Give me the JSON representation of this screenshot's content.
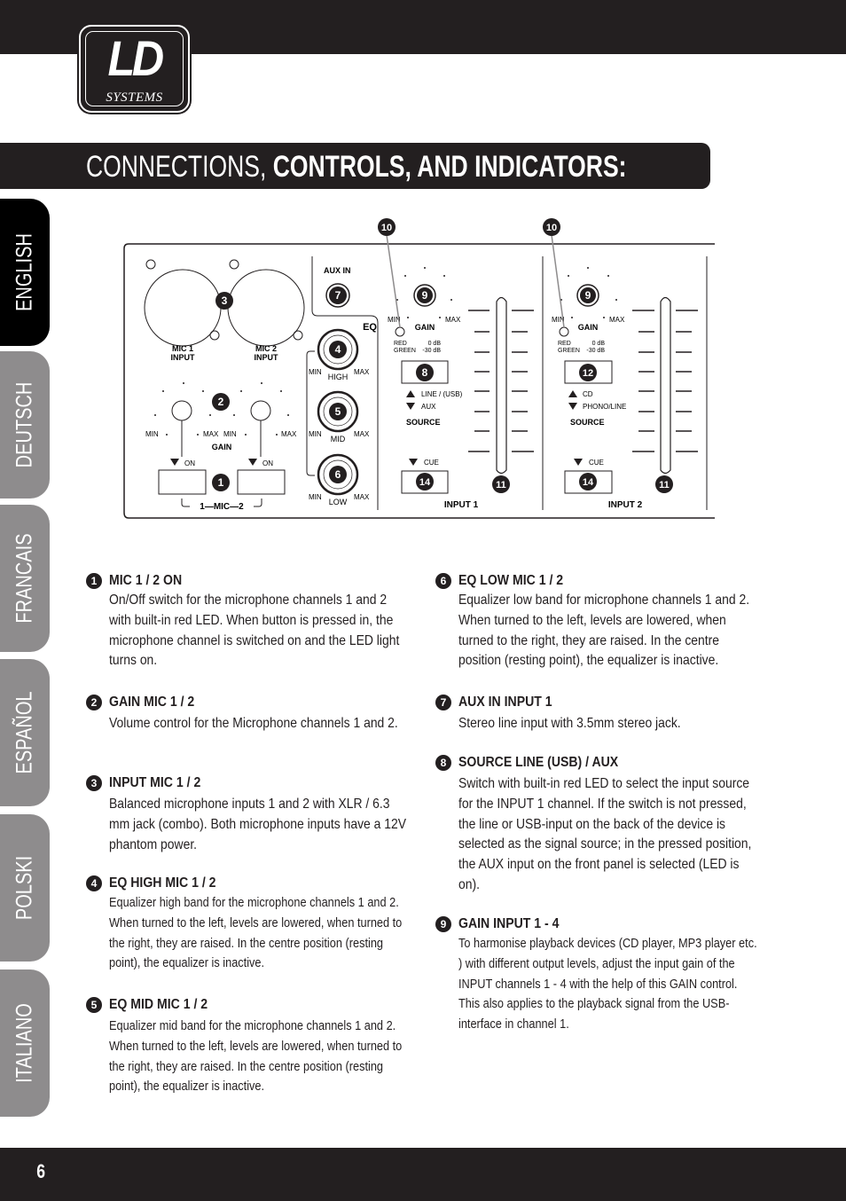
{
  "brand": {
    "logo_main": "LD",
    "logo_sub": "SYSTEMS"
  },
  "header": {
    "title_light": "CONNECTIONS, ",
    "title_bold": "CONTROLS, AND INDICATORS:"
  },
  "language_tabs": [
    {
      "label": "ENGLISH",
      "active": true
    },
    {
      "label": "DEUTSCH",
      "active": false
    },
    {
      "label": "FRANCAIS",
      "active": false
    },
    {
      "label": "ESPAÑOL",
      "active": false
    },
    {
      "label": "POLSKI",
      "active": false
    },
    {
      "label": "ITALIANO",
      "active": false
    }
  ],
  "diagram": {
    "mic1_input": [
      "MIC 1",
      "INPUT"
    ],
    "mic2_input": [
      "MIC 2",
      "INPUT"
    ],
    "aux_in": "AUX IN",
    "eq": "EQ",
    "min": "MIN",
    "max": "MAX",
    "high": "HIGH",
    "mid": "MID",
    "low": "LOW",
    "gain": "GAIN",
    "on": "ON",
    "mic_group": "1—MIC—2",
    "led_red": "RED",
    "led_green": "GREEN",
    "db_0": "0 dB",
    "db_30": "-30 dB",
    "input1_source_up": "LINE / (USB)",
    "input1_source_down": "AUX",
    "input2_source_up": "CD",
    "input2_source_down": "PHONO/LINE",
    "source": "SOURCE",
    "cue": "CUE",
    "input1": "INPUT 1",
    "input2": "INPUT 2",
    "callouts": [
      "1",
      "2",
      "3",
      "4",
      "5",
      "6",
      "7",
      "8",
      "9",
      "10",
      "11",
      "12",
      "14"
    ]
  },
  "items": [
    {
      "num": "1",
      "title": "MIC 1 / 2 ON",
      "body": "On/Off switch for the microphone channels 1 and 2 with built-in red LED. When button is pressed in, the microphone channel is switched on and the LED light turns on."
    },
    {
      "num": "2",
      "title": "GAIN MIC 1 / 2",
      "body": "Volume control for the Microphone channels 1 and 2."
    },
    {
      "num": "3",
      "title": "INPUT MIC 1 / 2",
      "body": "Balanced microphone inputs 1 and 2 with XLR / 6.3 mm jack (combo). Both microphone inputs have a 12V phantom power."
    },
    {
      "num": "4",
      "title": "EQ HIGH MIC 1 / 2",
      "body": "Equalizer high band for the microphone channels 1 and 2. When turned to the left, levels are lowered, when turned to the right, they are raised. In the centre position (resting point), the equalizer is inactive."
    },
    {
      "num": "5",
      "title": "EQ MID MIC 1 / 2",
      "body": "Equalizer mid band for the microphone channels 1 and 2. When turned to the left, levels are lowered, when turned to the right, they are raised. In the centre position (resting point), the equalizer is inactive."
    },
    {
      "num": "6",
      "title": "EQ LOW MIC 1 / 2",
      "body": "Equalizer low band for microphone channels 1 and 2. When turned to the left, levels are lowered, when turned to the right, they are raised. In the centre position (resting point), the equalizer is inactive."
    },
    {
      "num": "7",
      "title": "AUX IN INPUT 1",
      "body": "Stereo line input with 3.5mm stereo jack."
    },
    {
      "num": "8",
      "title": "SOURCE LINE (USB) / AUX",
      "body": "Switch with built-in red LED to select the input source for the INPUT 1 channel. If the switch is not pressed, the line or USB-input on the back of the device is selected as the signal source; in the pressed position, the AUX input on the front panel is selected (LED is on)."
    },
    {
      "num": "9",
      "title": "GAIN INPUT 1 - 4",
      "body": "To harmonise playback devices (CD player, MP3 player etc. ) with different output levels, adjust the input gain of the INPUT channels 1 - 4 with the help of this GAIN control. This also applies to the playback signal from the USB-interface in channel 1."
    }
  ],
  "footer": {
    "page_number": "6"
  }
}
